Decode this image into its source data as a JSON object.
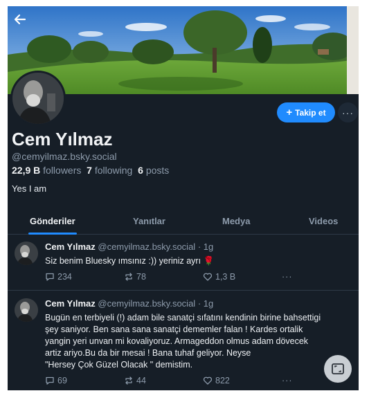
{
  "profile": {
    "display_name": "Cem Yılmaz",
    "handle": "@cemyilmaz.bsky.social",
    "followers_count": "22,9 B",
    "followers_label": "followers",
    "following_count": "7",
    "following_label": "following",
    "posts_count": "6",
    "posts_label": "posts",
    "bio": "Yes I am"
  },
  "buttons": {
    "follow_label": "Takip et",
    "more_label": "···"
  },
  "tabs": [
    {
      "label": "Gönderiler",
      "active": true
    },
    {
      "label": "Yanıtlar",
      "active": false
    },
    {
      "label": "Medya",
      "active": false
    },
    {
      "label": "Videos",
      "active": false
    }
  ],
  "posts": [
    {
      "author": "Cem Yılmaz",
      "handle": "@cemyilmaz.bsky.social",
      "separator": "·",
      "time": "1g",
      "text": "Siz benim Bluesky ımsınız :)) yeriniz ayrı 🌹",
      "replies": "234",
      "reposts": "78",
      "likes": "1,3 B",
      "more": "···"
    },
    {
      "author": "Cem Yılmaz",
      "handle": "@cemyilmaz.bsky.social",
      "separator": "·",
      "time": "1g",
      "text_lines": [
        "Bugün en terbiyeli (!) adam bile sanatçi sıfatını kendinin birine bahsettigi",
        "şey saniyor. Ben sana sana sanatçi dememler falan ! Kardes ortalik",
        "yangin yeri unvan mi kovaliyoruz. Armageddon olmus adam dövecek",
        "artiz ariyo.Bu da bir mesai ! Bana tuhaf geliyor. Neyse",
        "\"Hersey Çok Güzel Olacak \" demistim."
      ],
      "replies": "69",
      "reposts": "44",
      "likes": "822",
      "more": "···"
    }
  ],
  "colors": {
    "background": "#161e27",
    "accent": "#208bfe",
    "muted_text": "#8d9bab",
    "primary_text": "#f1f3f5"
  },
  "icons": [
    "back-arrow-icon",
    "plus-icon",
    "reply-icon",
    "repost-icon",
    "like-icon",
    "more-icon",
    "image-icon"
  ]
}
